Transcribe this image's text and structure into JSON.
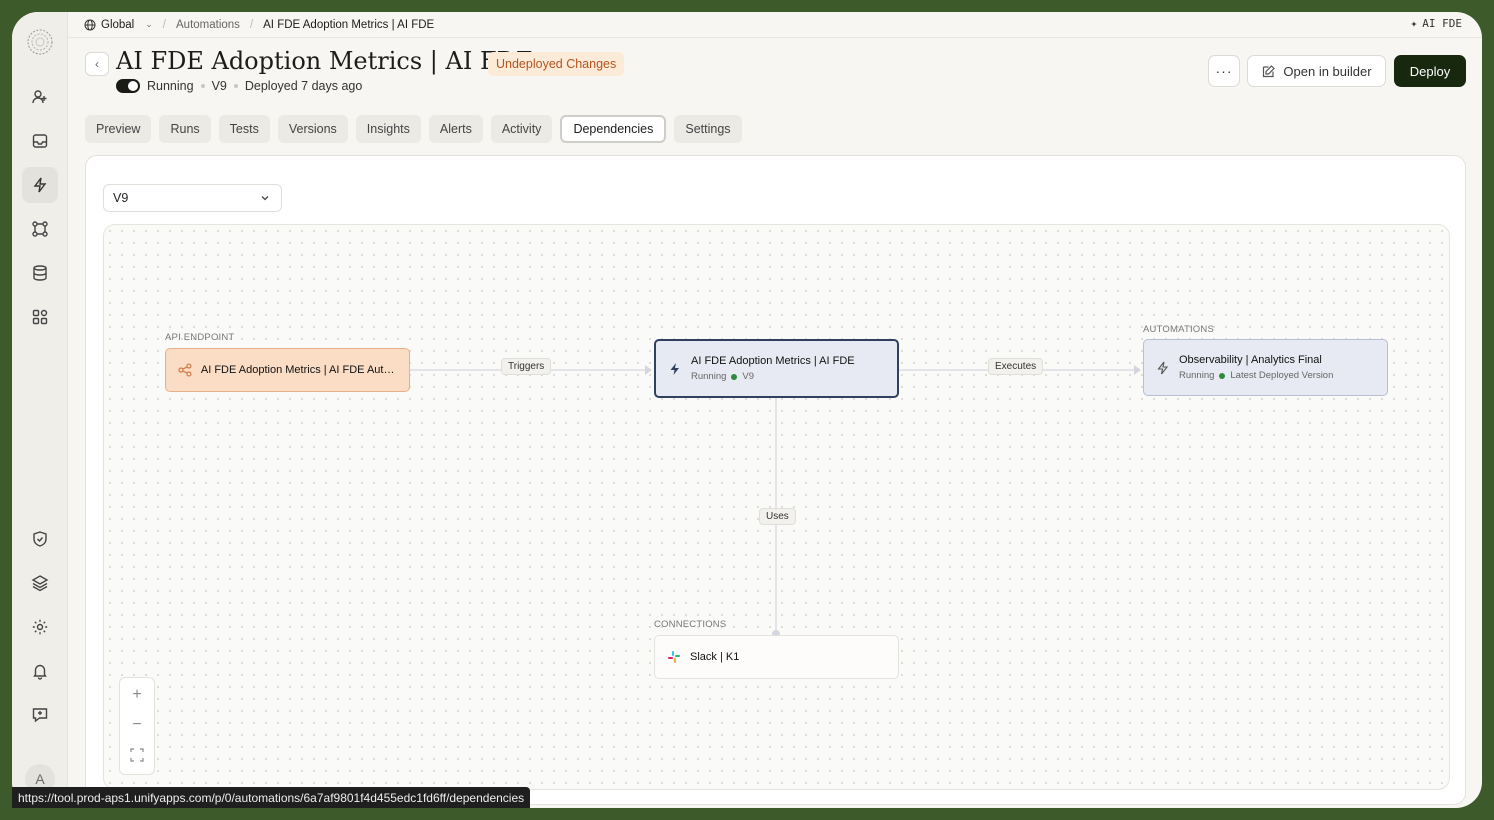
{
  "topbar": {
    "workspace": "Global",
    "breadcrumb_parent": "Automations",
    "breadcrumb_current": "AI FDE Adoption Metrics | AI FDE",
    "right_label": "AI FDE"
  },
  "header": {
    "title": "AI FDE Adoption Metrics | AI FDE",
    "badge": "Undeployed Changes",
    "status": "Running",
    "version": "V9",
    "deployed": "Deployed 7 days ago",
    "more_label": "···",
    "open_builder_label": "Open in builder",
    "deploy_label": "Deploy"
  },
  "tabs": [
    "Preview",
    "Runs",
    "Tests",
    "Versions",
    "Insights",
    "Alerts",
    "Activity",
    "Dependencies",
    "Settings"
  ],
  "active_tab": "Dependencies",
  "version_select": {
    "value": "V9"
  },
  "graph": {
    "api_group_label": "API ENDPOINT",
    "api_node_title": "AI FDE Adoption Metrics | AI FDE Auto...",
    "main_node_title": "AI FDE Adoption Metrics | AI FDE",
    "main_node_status": "Running",
    "main_node_version": "V9",
    "automations_group_label": "AUTOMATIONS",
    "obs_node_title": "Observability | Analytics Final",
    "obs_node_status": "Running",
    "obs_node_version": "Latest Deployed Version",
    "connections_group_label": "CONNECTIONS",
    "slack_node_title": "Slack | K1",
    "edge_triggers": "Triggers",
    "edge_executes": "Executes",
    "edge_uses": "Uses"
  },
  "sidebar": {
    "avatar_initial": "A",
    "icons": [
      "logo-icon",
      "users-icon",
      "inbox-icon",
      "bolt-icon",
      "workflow-icon",
      "database-icon",
      "apps-icon",
      "shield-icon",
      "layers-icon",
      "gear-icon",
      "bell-icon",
      "feedback-icon"
    ]
  },
  "status_url": "https://tool.prod-aps1.unifyapps.com/p/0/automations/6a7af9801f4d455edc1fd6ff/dependencies",
  "colors": {
    "deploy_bg": "#17280f",
    "badge_bg": "#fcebd8",
    "badge_text": "#b3541e",
    "api_node_bg": "#fbdcc4",
    "main_node_border": "#30405e",
    "running_dot": "#2f8a3e"
  }
}
